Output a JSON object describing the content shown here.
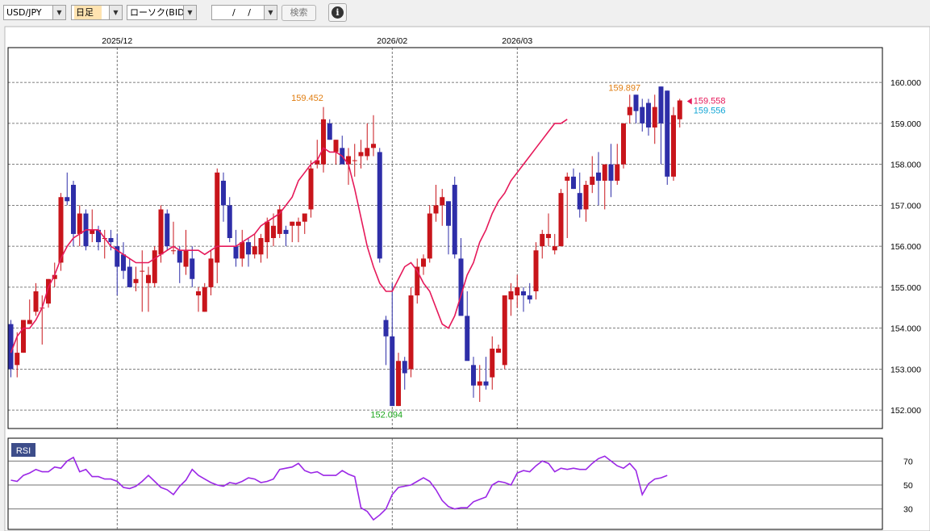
{
  "toolbar": {
    "pair": "USD/JPY",
    "timeframe": "日足",
    "chart_kind": "ローソク(BID)",
    "date": "/ /",
    "search": "検索"
  },
  "colors": {
    "up": "#c8151b",
    "down": "#2e2ea8",
    "ma": "#e6195a",
    "rsi": "#9b27e6",
    "high_label": "#e07d10",
    "low_label": "#1aa51a",
    "bid_label": "#e6195a",
    "ask_label": "#10a5d5"
  },
  "indicator_label": "RSI",
  "chart_data": [
    {
      "type": "candlestick",
      "ylim": [
        151.55,
        160.85
      ],
      "yticks": [
        "152.000",
        "153.000",
        "154.000",
        "155.000",
        "156.000",
        "157.000",
        "158.000",
        "159.000",
        "160.000"
      ],
      "date_labels": [
        {
          "label": "2025/12",
          "index": 17
        },
        {
          "label": "2026/02",
          "index": 61
        },
        {
          "label": "2026/03",
          "index": 81
        }
      ],
      "annotations": {
        "high_left": "159.452",
        "low": "152.094",
        "high_right": "159.897",
        "bid": "159.558",
        "ask": "159.556"
      },
      "series": [
        {
          "candles": [
            [
              154.1,
              154.2,
              152.8,
              153.0
            ],
            [
              153.1,
              153.9,
              152.8,
              153.4
            ],
            [
              153.4,
              154.2,
              153.4,
              154.2
            ],
            [
              154.1,
              154.7,
              154.1,
              154.2
            ],
            [
              154.4,
              155.1,
              154.3,
              154.9
            ],
            [
              154.5,
              154.8,
              153.6,
              154.5
            ],
            [
              154.6,
              155.2,
              154.5,
              155.2
            ],
            [
              155.2,
              155.6,
              155.0,
              155.3
            ],
            [
              155.6,
              157.3,
              155.4,
              157.2
            ],
            [
              157.2,
              157.8,
              157.0,
              157.1
            ],
            [
              157.5,
              157.6,
              156.0,
              156.3
            ],
            [
              156.3,
              157.0,
              156.0,
              156.8
            ],
            [
              156.8,
              156.9,
              155.9,
              156.0
            ],
            [
              156.3,
              156.9,
              156.1,
              156.4
            ],
            [
              156.4,
              156.5,
              155.9,
              156.1
            ],
            [
              156.2,
              156.4,
              155.7,
              156.2
            ],
            [
              156.2,
              156.4,
              155.9,
              156.1
            ],
            [
              156.0,
              156.3,
              154.8,
              155.5
            ],
            [
              155.8,
              156.1,
              155.2,
              155.4
            ],
            [
              155.5,
              155.7,
              155.1,
              155.0
            ],
            [
              155.1,
              155.5,
              154.9,
              155.2
            ],
            [
              155.4,
              155.9,
              154.4,
              155.4
            ],
            [
              155.1,
              155.5,
              154.4,
              155.3
            ],
            [
              155.1,
              156.0,
              155.0,
              155.9
            ],
            [
              155.8,
              157.0,
              155.6,
              156.9
            ],
            [
              156.8,
              156.9,
              155.9,
              156.0
            ],
            [
              155.9,
              156.6,
              155.8,
              155.9
            ],
            [
              155.9,
              156.0,
              155.1,
              155.6
            ],
            [
              155.5,
              156.4,
              155.3,
              155.9
            ],
            [
              155.7,
              156.0,
              155.0,
              155.2
            ],
            [
              154.8,
              155.0,
              154.4,
              154.9
            ],
            [
              154.4,
              155.1,
              154.4,
              155.0
            ],
            [
              155.0,
              155.9,
              154.8,
              155.7
            ],
            [
              155.6,
              157.9,
              155.1,
              157.8
            ],
            [
              157.6,
              157.8,
              156.6,
              157.0
            ],
            [
              157.0,
              157.2,
              156.1,
              156.2
            ],
            [
              156.0,
              156.4,
              155.5,
              155.7
            ],
            [
              155.7,
              156.4,
              155.5,
              156.1
            ],
            [
              156.1,
              156.2,
              155.5,
              155.8
            ],
            [
              155.8,
              156.3,
              155.7,
              156.0
            ],
            [
              155.8,
              156.3,
              155.6,
              156.2
            ],
            [
              156.1,
              156.7,
              155.7,
              156.6
            ],
            [
              156.2,
              156.8,
              156.0,
              156.5
            ],
            [
              156.3,
              157.0,
              156.2,
              156.9
            ],
            [
              156.4,
              156.5,
              156.0,
              156.3
            ],
            [
              156.5,
              156.6,
              156.1,
              156.6
            ],
            [
              156.5,
              156.7,
              156.1,
              156.6
            ],
            [
              156.6,
              156.7,
              156.3,
              156.8
            ],
            [
              156.9,
              158.1,
              156.7,
              157.9
            ],
            [
              158.0,
              158.6,
              157.9,
              158.1
            ],
            [
              158.0,
              159.4,
              157.8,
              159.1
            ],
            [
              159.0,
              159.1,
              158.6,
              158.6
            ],
            [
              158.3,
              158.6,
              158.0,
              158.6
            ],
            [
              158.4,
              158.7,
              158.1,
              158.0
            ],
            [
              158.0,
              158.4,
              157.5,
              158.2
            ],
            [
              158.1,
              158.5,
              157.7,
              158.1
            ],
            [
              158.2,
              158.6,
              157.9,
              158.3
            ],
            [
              158.2,
              159.0,
              158.1,
              158.4
            ],
            [
              158.4,
              159.2,
              158.2,
              158.5
            ],
            [
              158.3,
              158.4,
              155.6,
              155.7
            ],
            [
              154.2,
              154.3,
              153.1,
              153.8
            ],
            [
              153.8,
              155.1,
              152.2,
              152.1
            ],
            [
              152.1,
              153.4,
              152.1,
              153.2
            ],
            [
              153.2,
              153.3,
              152.5,
              152.9
            ],
            [
              153.0,
              155.0,
              152.8,
              154.8
            ],
            [
              154.8,
              155.7,
              154.6,
              155.5
            ],
            [
              155.5,
              155.8,
              155.3,
              155.7
            ],
            [
              155.7,
              157.0,
              155.6,
              156.8
            ],
            [
              156.8,
              157.5,
              156.6,
              157.0
            ],
            [
              157.0,
              157.4,
              156.5,
              157.2
            ],
            [
              157.1,
              157.1,
              155.8,
              156.5
            ],
            [
              157.5,
              157.7,
              155.7,
              155.8
            ],
            [
              155.7,
              156.2,
              154.5,
              154.3
            ],
            [
              154.3,
              154.9,
              153.3,
              153.2
            ],
            [
              153.1,
              153.3,
              152.3,
              152.6
            ],
            [
              152.6,
              153.1,
              152.2,
              152.7
            ],
            [
              152.7,
              153.3,
              152.5,
              152.6
            ],
            [
              152.8,
              153.8,
              152.5,
              153.5
            ],
            [
              153.4,
              153.6,
              153.4,
              153.5
            ],
            [
              153.1,
              154.8,
              153.0,
              154.8
            ],
            [
              154.7,
              155.1,
              154.3,
              154.9
            ],
            [
              154.8,
              155.3,
              154.5,
              155.0
            ],
            [
              154.9,
              155.0,
              154.4,
              154.8
            ],
            [
              154.8,
              155.1,
              154.6,
              154.7
            ],
            [
              154.9,
              156.1,
              154.7,
              155.9
            ],
            [
              156.0,
              156.4,
              155.7,
              156.3
            ],
            [
              156.2,
              156.8,
              156.0,
              156.3
            ],
            [
              155.9,
              156.3,
              155.8,
              156.0
            ],
            [
              156.0,
              157.4,
              156.0,
              157.3
            ],
            [
              157.6,
              157.8,
              156.2,
              157.7
            ],
            [
              157.7,
              157.9,
              157.4,
              157.4
            ],
            [
              157.3,
              157.8,
              156.7,
              156.9
            ],
            [
              156.9,
              157.6,
              156.6,
              157.5
            ],
            [
              157.5,
              158.2,
              157.3,
              157.7
            ],
            [
              157.8,
              158.3,
              157.0,
              157.6
            ],
            [
              157.6,
              157.8,
              156.9,
              158.0
            ],
            [
              158.0,
              158.5,
              157.2,
              157.6
            ],
            [
              157.6,
              158.5,
              157.5,
              158.0
            ],
            [
              158.0,
              159.0,
              157.9,
              159.0
            ],
            [
              159.2,
              159.7,
              159.0,
              159.4
            ],
            [
              159.7,
              159.7,
              159.0,
              159.3
            ],
            [
              159.4,
              159.6,
              158.8,
              159.0
            ],
            [
              159.5,
              159.6,
              158.7,
              158.9
            ],
            [
              158.9,
              159.7,
              158.5,
              159.4
            ],
            [
              159.9,
              159.9,
              158.0,
              159.0
            ],
            [
              159.8,
              159.8,
              157.5,
              157.7
            ],
            [
              157.7,
              159.4,
              157.6,
              159.2
            ],
            [
              159.1,
              159.6,
              158.9,
              159.56
            ]
          ],
          "ma": [
            153.4,
            153.8,
            154.0,
            154.0,
            154.2,
            154.5,
            155.0,
            155.3,
            155.7,
            156.0,
            156.2,
            156.3,
            156.4,
            156.4,
            156.4,
            156.2,
            156.0,
            155.9,
            155.8,
            155.7,
            155.6,
            155.6,
            155.6,
            155.7,
            155.8,
            155.9,
            156.0,
            155.9,
            155.9,
            155.9,
            155.9,
            155.8,
            155.9,
            156.0,
            156.0,
            156.0,
            156.0,
            156.1,
            156.2,
            156.3,
            156.5,
            156.6,
            156.7,
            156.8,
            157.0,
            157.2,
            157.6,
            157.8,
            158.0,
            158.1,
            158.4,
            158.3,
            158.3,
            158.2,
            158.0,
            157.4,
            156.7,
            156.0,
            155.5,
            155.1,
            154.9,
            154.9,
            155.2,
            155.5,
            155.6,
            155.4,
            155.1,
            154.9,
            154.5,
            154.1,
            154.0,
            154.3,
            154.8,
            155.3,
            155.6,
            156.1,
            156.4,
            156.8,
            157.1,
            157.3,
            157.6,
            157.8,
            158.0,
            158.2,
            158.4,
            158.6,
            158.8,
            159.0,
            159.0,
            159.1
          ]
        }
      ]
    },
    {
      "type": "line",
      "name": "RSI",
      "ylim": [
        13,
        89
      ],
      "yticks": [
        "70",
        "50",
        "30"
      ],
      "series": [
        {
          "values": [
            54,
            53,
            58,
            60,
            63,
            61,
            61,
            65,
            64,
            70,
            73,
            61,
            63,
            57,
            57,
            55,
            55,
            53,
            48,
            47,
            49,
            53,
            58,
            53,
            48,
            46,
            42,
            49,
            54,
            63,
            58,
            55,
            52,
            50,
            49,
            52,
            51,
            53,
            56,
            55,
            52,
            53,
            55,
            63,
            64,
            65,
            68,
            62,
            60,
            61,
            58,
            58,
            58,
            62,
            59,
            57,
            31,
            28,
            21,
            25,
            30,
            42,
            48,
            49,
            50,
            53,
            56,
            53,
            46,
            37,
            32,
            30,
            31,
            31,
            36,
            38,
            40,
            50,
            53,
            52,
            50,
            60,
            62,
            61,
            66,
            70,
            68,
            61,
            64,
            63,
            64,
            63,
            63,
            68,
            72,
            74,
            70,
            66,
            64,
            68,
            62,
            42,
            51,
            55,
            56,
            58
          ]
        }
      ]
    }
  ]
}
